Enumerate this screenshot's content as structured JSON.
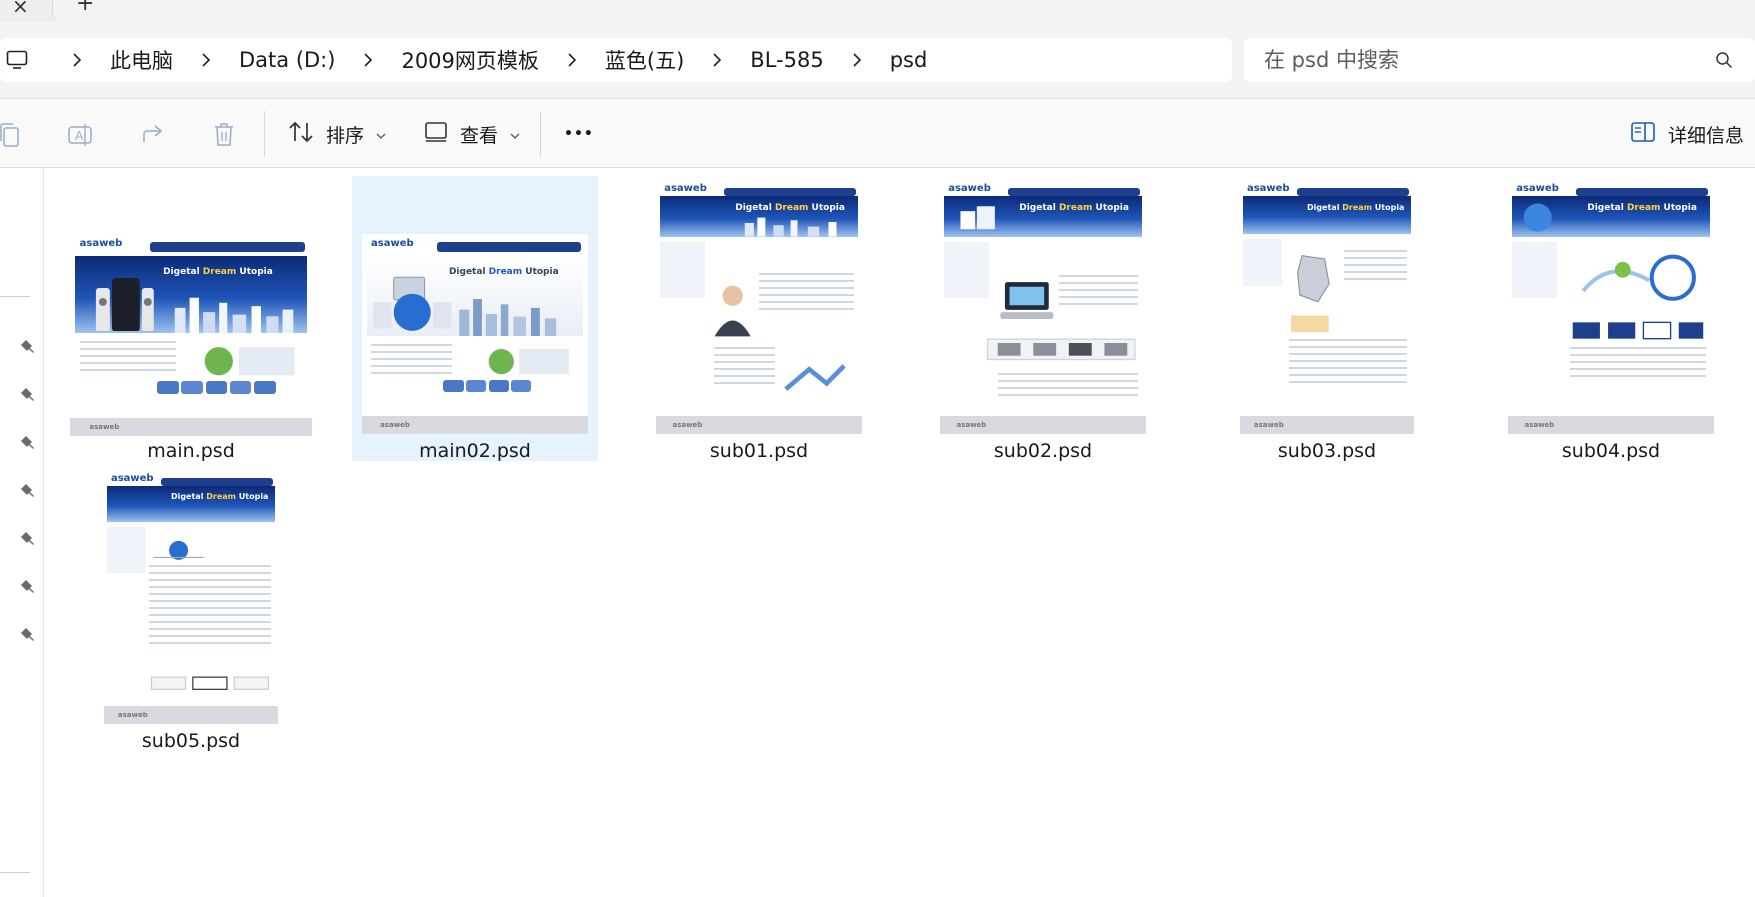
{
  "tabs": {
    "close_glyph": "×",
    "new_glyph": "+"
  },
  "breadcrumb": {
    "items": [
      "此电脑",
      "Data (D:)",
      "2009网页模板",
      "蓝色(五)",
      "BL-585",
      "psd"
    ]
  },
  "search": {
    "placeholder": "在 psd 中搜索"
  },
  "commandbar": {
    "sort_label": "排序",
    "view_label": "查看",
    "more_label": "•••",
    "details_label": "详细信息"
  },
  "files": [
    {
      "name": "main.psd",
      "selected": false
    },
    {
      "name": "main02.psd",
      "selected": true
    },
    {
      "name": "sub01.psd",
      "selected": false
    },
    {
      "name": "sub02.psd",
      "selected": false
    },
    {
      "name": "sub03.psd",
      "selected": false
    },
    {
      "name": "sub04.psd",
      "selected": false
    },
    {
      "name": "sub05.psd",
      "selected": false
    }
  ],
  "thumbnail_text": {
    "logo": "asaweb",
    "banner_title_pre": "Digetal ",
    "banner_title_em": "Dream",
    "banner_title_post": " Utopia"
  },
  "colors": {
    "accent": "#1d3f8c",
    "selection": "#e6f2fd",
    "chrome": "#f3f3f3"
  }
}
